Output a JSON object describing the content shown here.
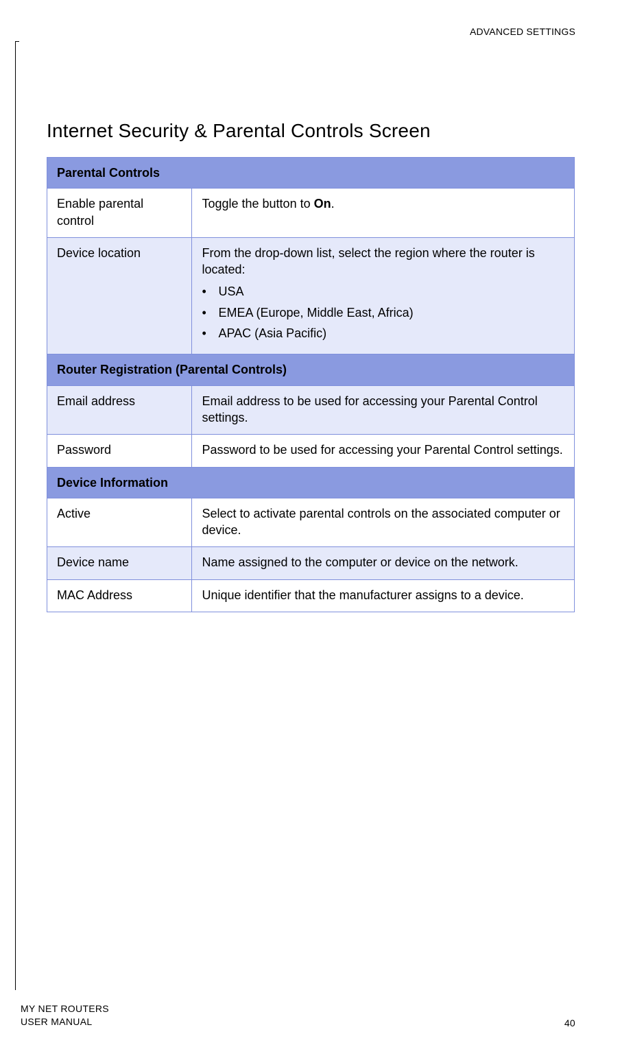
{
  "chapter": "ADVANCED SETTINGS",
  "title": "Internet Security & Parental Controls Screen",
  "sections": [
    {
      "header": "Parental Controls",
      "rows": [
        {
          "label": "Enable parental control",
          "desc_pre": "Toggle the button to ",
          "desc_bold": "On",
          "desc_post": ".",
          "alt": false
        },
        {
          "label": "Device location",
          "desc_intro": "From the drop-down list, select the region where the router is located:",
          "items": [
            "USA",
            "EMEA (Europe, Middle East, Africa)",
            "APAC (Asia Pacific)"
          ],
          "alt": true
        }
      ]
    },
    {
      "header": "Router Registration (Parental Controls)",
      "rows": [
        {
          "label": "Email address",
          "desc": "Email address to be used for accessing your Parental Control settings.",
          "alt": true
        },
        {
          "label": "Password",
          "desc": "Password to be used for accessing your Parental Control settings.",
          "alt": false
        }
      ]
    },
    {
      "header": "Device Information",
      "rows": [
        {
          "label": "Active",
          "desc": "Select to activate parental controls on the associated computer or device.",
          "alt": false
        },
        {
          "label": "Device name",
          "desc": "Name assigned to the computer or device on the network.",
          "alt": true
        },
        {
          "label": "MAC Address",
          "desc": "Unique identifier that the manufacturer assigns to a device.",
          "alt": false
        }
      ]
    }
  ],
  "footer": {
    "line1": "MY NET ROUTERS",
    "line2": "USER MANUAL",
    "page": "40"
  }
}
